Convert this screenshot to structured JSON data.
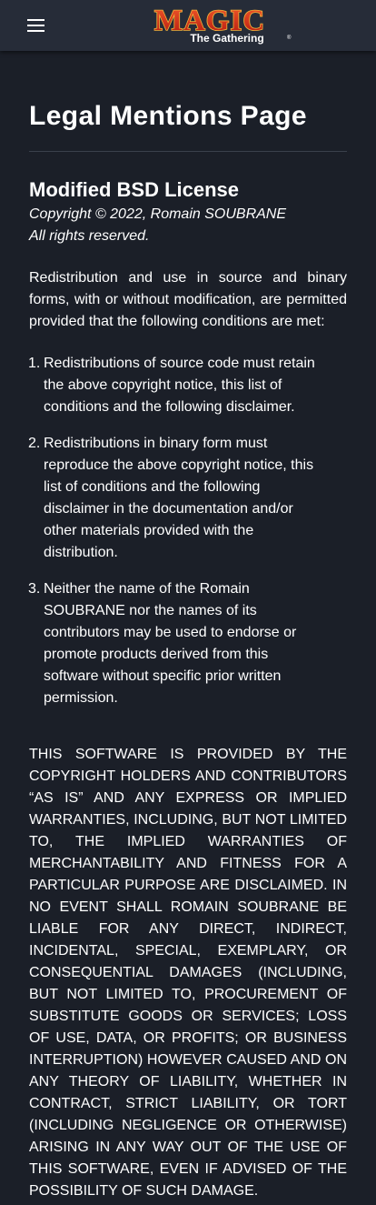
{
  "header": {
    "logo_main": "MAGIC",
    "logo_sub": "The Gathering",
    "logo_mark": "®"
  },
  "page": {
    "title": "Legal Mentions Page"
  },
  "license": {
    "title": "Modified BSD License",
    "copyright": "Copyright © 2022, Romain SOUBRANE",
    "rights": "All rights reserved.",
    "intro": "Redistribution and use in source and binary forms, with or without modification, are permitted provided that the following conditions are met:",
    "conditions": [
      {
        "number": "1.",
        "text": "Redistributions of source code must retain the above copyright notice, this list of conditions and the following disclaimer."
      },
      {
        "number": "2.",
        "text": "Redistributions in binary form must reproduce the above copyright notice, this list of conditions and the following disclaimer in the documentation and/or other materials provided with the distribution."
      },
      {
        "number": "3.",
        "text": "Neither the name of the Romain SOUBRANE nor the names of its contributors may be used to endorse or promote products derived from this software without specific prior written permission."
      }
    ],
    "disclaimer": "THIS SOFTWARE IS PROVIDED BY THE COPYRIGHT HOLDERS AND CONTRIBUTORS “AS IS” AND ANY EXPRESS OR IMPLIED WARRANTIES, INCLUDING, BUT NOT LIMITED TO, THE IMPLIED WARRANTIES OF MERCHANTABILITY AND FITNESS FOR A PARTICULAR PURPOSE ARE DISCLAIMED. IN NO EVENT SHALL ROMAIN SOUBRANE BE LIABLE FOR ANY DIRECT, INDIRECT, INCIDENTAL, SPECIAL, EXEMPLARY, OR CONSEQUENTIAL DAMAGES (INCLUDING, BUT NOT LIMITED TO, PROCUREMENT OF SUBSTITUTE GOODS OR SERVICES; LOSS OF USE, DATA, OR PROFITS; OR BUSINESS INTERRUPTION) HOWEVER CAUSED AND ON ANY THEORY OF LIABILITY, WHETHER IN CONTRACT, STRICT LIABILITY, OR TORT (INCLUDING NEGLIGENCE OR OTHERWISE) ARISING IN ANY WAY OUT OF THE USE OF THIS SOFTWARE, EVEN IF ADVISED OF THE POSSIBILITY OF SUCH DAMAGE."
  },
  "icons": {
    "menu": "hamburger-menu-icon"
  },
  "colors": {
    "background": "#1b1f28",
    "header": "#262c38",
    "logo_red": "#d8281c",
    "logo_gold": "#f3b53a",
    "text": "#ffffff"
  }
}
